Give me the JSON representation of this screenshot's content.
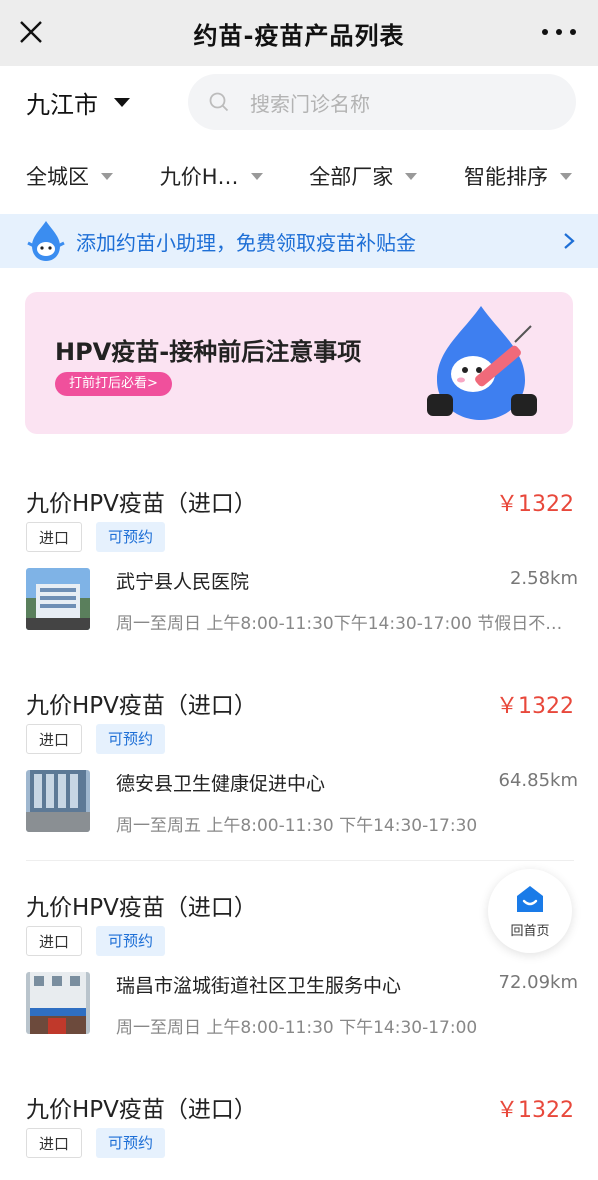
{
  "titlebar": {
    "title": "约苗-疫苗产品列表"
  },
  "location": {
    "city": "九江市"
  },
  "search": {
    "placeholder": "搜索门诊名称"
  },
  "filters": [
    {
      "label": "全城区"
    },
    {
      "label": "九价H…"
    },
    {
      "label": "全部厂家"
    },
    {
      "label": "智能排序"
    }
  ],
  "helper_bar": {
    "text": "添加约苗小助理，免费领取疫苗补贴金"
  },
  "banner": {
    "title": "HPV疫苗-接种前后注意事项",
    "tag": "打前打后必看>"
  },
  "listings": [
    {
      "name": "九价HPV疫苗（进口）",
      "price": "￥1322",
      "tag1": "进口",
      "tag2": "可预约",
      "hospital": "武宁县人民医院",
      "distance": "2.58km",
      "hours": "周一至周日 上午8:00-11:30下午14:30-17:00 节假日不…"
    },
    {
      "name": "九价HPV疫苗（进口）",
      "price": "￥1322",
      "tag1": "进口",
      "tag2": "可预约",
      "hospital": "德安县卫生健康促进中心",
      "distance": "64.85km",
      "hours": "周一至周五 上午8:00-11:30 下午14:30-17:30"
    },
    {
      "name": "九价HPV疫苗（进口）",
      "price": "",
      "tag1": "进口",
      "tag2": "可预约",
      "hospital": "瑞昌市湓城街道社区卫生服务中心",
      "distance": "72.09km",
      "hours": "周一至周日 上午8:00-11:30 下午14:30-17:00"
    },
    {
      "name": "九价HPV疫苗（进口）",
      "price": "￥1322",
      "tag1": "进口",
      "tag2": "可预约"
    }
  ],
  "home_button": {
    "label": "回首页"
  },
  "colors": {
    "accent": "#1e6fd6",
    "price": "#e8483b",
    "banner_bg": "#fbe3f2",
    "banner_tag": "#f0509c"
  }
}
